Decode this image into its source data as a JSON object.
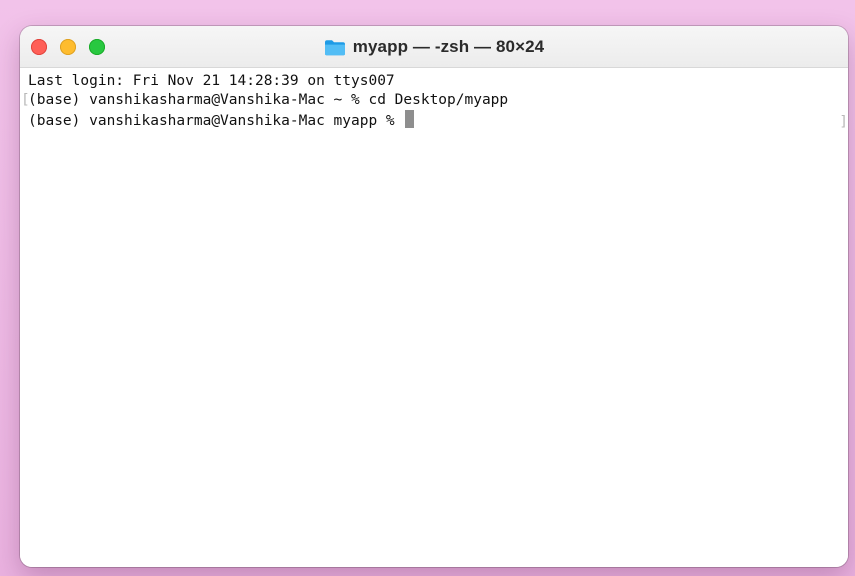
{
  "window": {
    "title": "myapp — -zsh — 80×24",
    "title_icon": "folder-icon",
    "controls": {
      "close_color": "#ff5f57",
      "minimize_color": "#febc2e",
      "maximize_color": "#28c840"
    }
  },
  "terminal": {
    "lines": [
      "Last login: Fri Nov 21 14:28:39 on ttys007",
      "(base) vanshikasharma@Vanshika-Mac ~ % cd Desktop/myapp",
      "(base) vanshikasharma@Vanshika-Mac myapp % "
    ],
    "mark_open": "[",
    "mark_close": "]"
  }
}
